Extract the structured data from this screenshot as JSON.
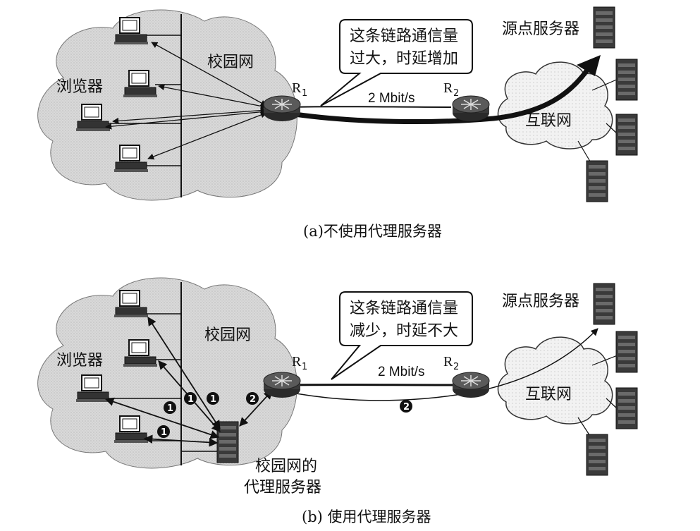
{
  "diagrams": [
    {
      "caption": "(a)不使用代理服务器",
      "browser_label": "浏览器",
      "campus_label": "校园网",
      "origin_label": "源点服务器",
      "internet_label": "互联网",
      "router1": {
        "letter": "R",
        "sub": "1"
      },
      "router2": {
        "letter": "R",
        "sub": "2"
      },
      "link_rate": "2 Mbit/s",
      "callout_line1": "这条链路通信量",
      "callout_line2": "过大，时延增加"
    },
    {
      "caption": "(b) 使用代理服务器",
      "browser_label": "浏览器",
      "campus_label": "校园网",
      "origin_label": "源点服务器",
      "internet_label": "互联网",
      "router1": {
        "letter": "R",
        "sub": "1"
      },
      "router2": {
        "letter": "R",
        "sub": "2"
      },
      "link_rate": "2 Mbit/s",
      "callout_line1": "这条链路通信量",
      "callout_line2": "减少，时延不大",
      "proxy_line1": "校园网的",
      "proxy_line2": "代理服务器",
      "step_markers": [
        "1",
        "1",
        "1",
        "1",
        "2",
        "2"
      ]
    }
  ],
  "colors": {
    "cloud": "#d6d6d6",
    "ink": "#111111",
    "router": "#4a4a4a"
  }
}
